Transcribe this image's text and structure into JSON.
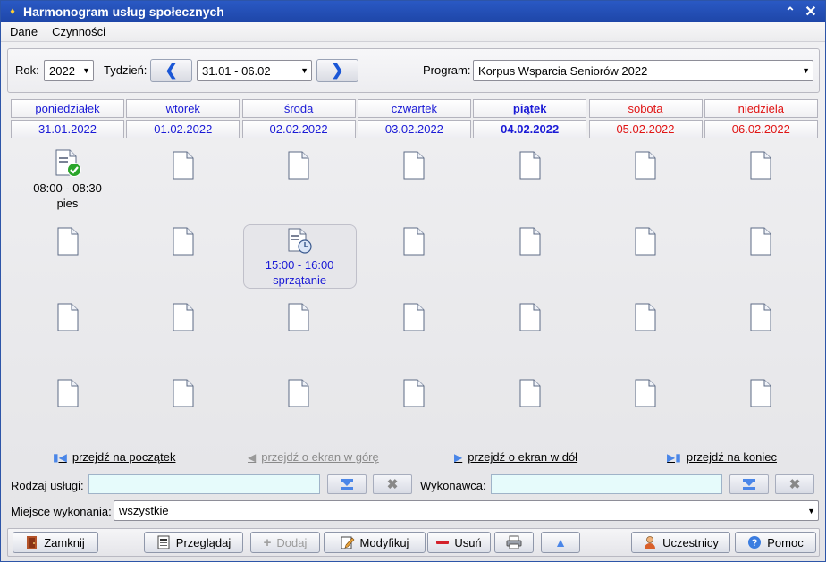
{
  "window": {
    "title": "Harmonogram usług społecznych"
  },
  "menu": {
    "items": [
      "Dane",
      "Czynności"
    ]
  },
  "filters": {
    "year_label": "Rok:",
    "year_value": "2022",
    "week_label": "Tydzień:",
    "week_value": "31.01 - 06.02",
    "program_label": "Program:",
    "program_value": "Korpus Wsparcia Seniorów 2022"
  },
  "days": [
    {
      "name": "poniedziałek",
      "date": "31.01.2022",
      "color": "#1a1ad6",
      "bold": false
    },
    {
      "name": "wtorek",
      "date": "01.02.2022",
      "color": "#1a1ad6",
      "bold": false
    },
    {
      "name": "środa",
      "date": "02.02.2022",
      "color": "#1a1ad6",
      "bold": false
    },
    {
      "name": "czwartek",
      "date": "03.02.2022",
      "color": "#1a1ad6",
      "bold": false
    },
    {
      "name": "piątek",
      "date": "04.02.2022",
      "color": "#1a1ad6",
      "bold": true
    },
    {
      "name": "sobota",
      "date": "05.02.2022",
      "color": "#e01414",
      "bold": false
    },
    {
      "name": "niedziela",
      "date": "06.02.2022",
      "color": "#e01414",
      "bold": false
    }
  ],
  "appointments": [
    {
      "row": 0,
      "col": 0,
      "time": "08:00 - 08:30",
      "service": "pies",
      "icon": "doc-check-icon",
      "text_color": "#000000",
      "highlight": false
    },
    {
      "row": 1,
      "col": 2,
      "time": "15:00 - 16:00",
      "service": "sprzątanie",
      "icon": "doc-clock-icon",
      "text_color": "#1a1ad6",
      "highlight": true
    }
  ],
  "rows": 4,
  "navigation": {
    "first": "przejdź na początek",
    "up": "przejdź o ekran w górę",
    "down": "przejdź o ekran w dół",
    "last": "przejdź na koniec"
  },
  "form": {
    "service_type_label": "Rodzaj usługi:",
    "service_type_value": "",
    "executor_label": "Wykonawca:",
    "executor_value": "",
    "place_label": "Miejsce wykonania:",
    "place_value": "wszystkie"
  },
  "buttons": {
    "close": "Zamknij",
    "browse": "Przeglądaj",
    "add": "Dodaj",
    "modify": "Modyfikuj",
    "delete": "Usuń",
    "participants": "Uczestnicy",
    "help": "Pomoc"
  },
  "colors": {
    "titlebar": "#2a59c4",
    "weekday": "#1a1ad6",
    "weekend": "#e01414",
    "field_bg": "#e6fbfb"
  }
}
